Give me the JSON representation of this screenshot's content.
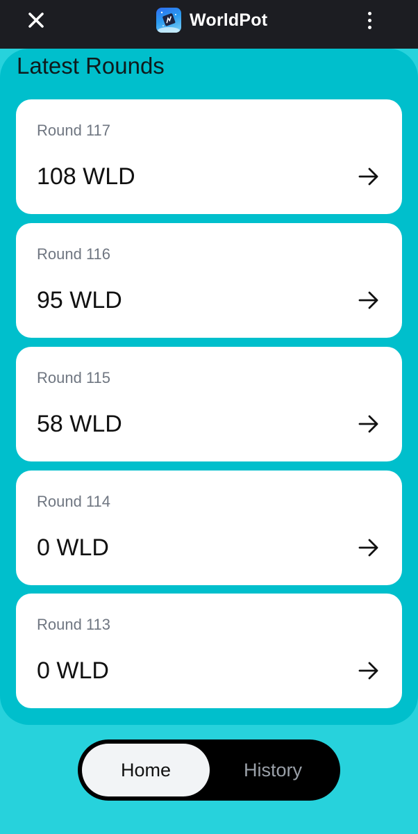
{
  "header": {
    "app_name": "WorldPot",
    "close_icon": "close-icon",
    "menu_icon": "more-vertical-icon",
    "logo_icon": "worldpot-logo-icon"
  },
  "main": {
    "title": "Latest Rounds",
    "rounds": [
      {
        "label": "Round 117",
        "amount": "108 WLD"
      },
      {
        "label": "Round 116",
        "amount": "95 WLD"
      },
      {
        "label": "Round 115",
        "amount": "58 WLD"
      },
      {
        "label": "Round 114",
        "amount": "0 WLD"
      },
      {
        "label": "Round 113",
        "amount": "0 WLD"
      }
    ]
  },
  "nav": {
    "home_label": "Home",
    "history_label": "History",
    "active": "Home"
  },
  "colors": {
    "header_bg": "#1c1d22",
    "panel_bg": "#00bfcc",
    "page_bg": "#27d2dc",
    "card_bg": "#ffffff",
    "nav_bg": "#000000"
  }
}
